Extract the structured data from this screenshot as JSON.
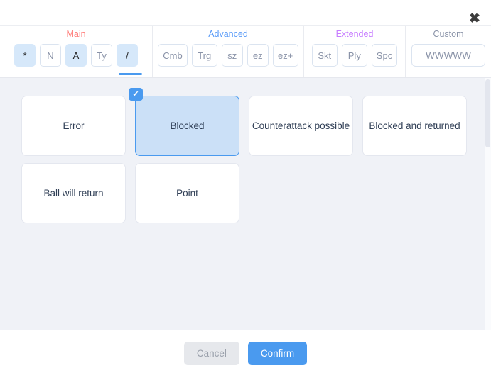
{
  "window": {
    "close_label": "✖"
  },
  "toolbar": {
    "sections": [
      {
        "label": "Main",
        "color": "#ff7875",
        "buttons": [
          {
            "label": "*",
            "selected": true
          },
          {
            "label": "N",
            "selected": false
          },
          {
            "label": "A",
            "selected": true
          },
          {
            "label": "Ty",
            "selected": false
          },
          {
            "label": "/",
            "selected": true
          }
        ],
        "active_indicator_under": "/"
      },
      {
        "label": "Advanced",
        "color": "#5b9cf8",
        "buttons": [
          {
            "label": "Cmb",
            "selected": false
          },
          {
            "label": "Trg",
            "selected": false
          },
          {
            "label": "sz",
            "selected": false
          },
          {
            "label": "ez",
            "selected": false
          },
          {
            "label": "ez+",
            "selected": false
          }
        ]
      },
      {
        "label": "Extended",
        "color": "#c77dff",
        "buttons": [
          {
            "label": "Skt",
            "selected": false
          },
          {
            "label": "Ply",
            "selected": false
          },
          {
            "label": "Spc",
            "selected": false
          }
        ]
      },
      {
        "label": "Custom",
        "color": "#8a93a8",
        "input": {
          "value": "",
          "placeholder": "WWWWW"
        }
      }
    ]
  },
  "content": {
    "cards": [
      {
        "label": "Error",
        "selected": false
      },
      {
        "label": "Blocked",
        "selected": true
      },
      {
        "label": "Counterattack possible",
        "selected": false
      },
      {
        "label": "Blocked and returned",
        "selected": false
      },
      {
        "label": "Ball will return",
        "selected": false
      },
      {
        "label": "Point",
        "selected": false
      }
    ],
    "check_mark": "✔"
  },
  "footer": {
    "cancel_label": "Cancel",
    "confirm_label": "Confirm"
  },
  "colors": {
    "accent": "#4a9aef",
    "selected_card_bg": "#cbe0f7",
    "selected_button_bg": "#d6e8fa",
    "content_bg": "#f0f2f7",
    "card_text": "#2f3e55"
  }
}
